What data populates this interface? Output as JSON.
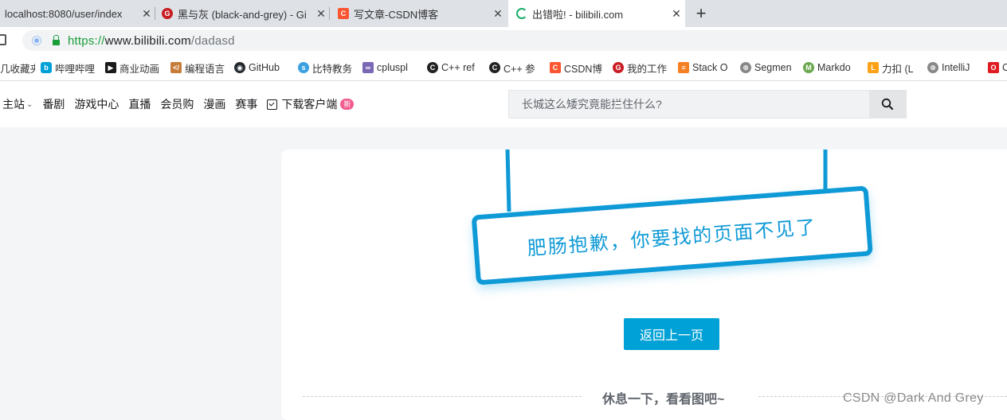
{
  "browser": {
    "tabs": [
      {
        "title": "localhost:8080/user/index",
        "favicon": "none",
        "active": false
      },
      {
        "title": "黑与灰 (black-and-grey) - Gi",
        "favicon": "gitee-icon",
        "active": false
      },
      {
        "title": "写文章-CSDN博客",
        "favicon": "csdn-icon",
        "active": false
      },
      {
        "title": "出错啦! - bilibili.com",
        "favicon": "loading-icon",
        "active": true
      }
    ],
    "new_tab_label": "+",
    "close_label": "✕",
    "url": {
      "scheme": "https",
      "separator": "://",
      "host": "www.bilibili.com",
      "path": "/dadasd"
    },
    "bookmarks": [
      {
        "label": "几收藏夹",
        "icon": "folder-icon",
        "color": "#f4b400"
      },
      {
        "label": "哔哩哔哩",
        "icon": "bilibili-icon",
        "color": "#00a1d6"
      },
      {
        "label": "商业动画",
        "icon": "animation-icon",
        "color": "#1a1a1a"
      },
      {
        "label": "编程语言",
        "icon": "code-icon",
        "color": "#c77d3a"
      },
      {
        "label": "GitHub",
        "icon": "github-icon",
        "color": "#24292e"
      },
      {
        "label": "比特教务",
        "icon": "bit-icon",
        "color": "#3aa0e0"
      },
      {
        "label": "cpluspl",
        "icon": "cplusplus-icon",
        "color": "#7b68b5"
      },
      {
        "label": "C++ ref",
        "icon": "cppref-icon",
        "color": "#222222"
      },
      {
        "label": "C++ 参",
        "icon": "cppref-icon",
        "color": "#222222"
      },
      {
        "label": "CSDN博",
        "icon": "csdn-icon",
        "color": "#fc5531"
      },
      {
        "label": "我的工作",
        "icon": "gitee-icon",
        "color": "#c71d23"
      },
      {
        "label": "Stack O",
        "icon": "stackoverflow-icon",
        "color": "#f48024"
      },
      {
        "label": "Segmen",
        "icon": "globe-icon",
        "color": "#666666"
      },
      {
        "label": "Markdo",
        "icon": "markdown-icon",
        "color": "#6aa84f"
      },
      {
        "label": "力扣 (L",
        "icon": "leetcode-icon",
        "color": "#ffa116"
      },
      {
        "label": "IntelliJ",
        "icon": "globe-icon",
        "color": "#666666"
      },
      {
        "label": "C",
        "icon": "oracle-icon",
        "color": "#e01b22"
      }
    ]
  },
  "site": {
    "nav": [
      {
        "label": "主站",
        "has_dropdown": true
      },
      {
        "label": "番剧"
      },
      {
        "label": "游戏中心"
      },
      {
        "label": "直播"
      },
      {
        "label": "会员购"
      },
      {
        "label": "漫画"
      },
      {
        "label": "赛事"
      }
    ],
    "download": {
      "label": "下载客户端",
      "badge": "新"
    },
    "search": {
      "placeholder": "长城这么矮究竟能拦住什么?"
    }
  },
  "error_page": {
    "sign_text": "肥肠抱歉，你要找的页面不见了",
    "back_button": "返回上一页",
    "rest_text": "休息一下，看看图吧~"
  },
  "watermark": "CSDN @Dark And Grey",
  "colors": {
    "accent": "#00a1d6",
    "sign_border": "#0f9ad6",
    "badge": "#f25d8e",
    "secure": "#1a9e3a"
  }
}
